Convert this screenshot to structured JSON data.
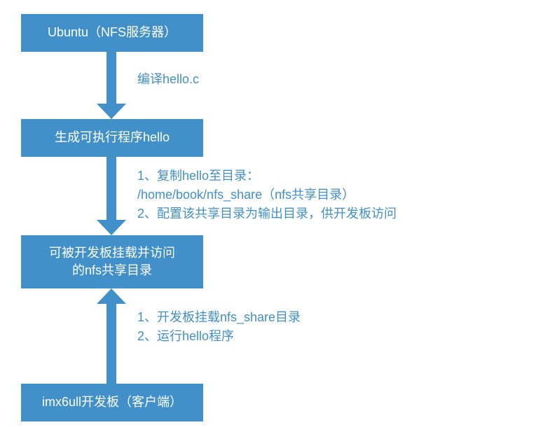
{
  "nodes": {
    "server": "Ubuntu（NFS服务器）",
    "compile_result": "生成可执行程序hello",
    "nfs_dir": "可被开发板挂载并访问\n的nfs共享目录",
    "client": "imx6ull开发板（客户端）"
  },
  "edges": {
    "compile": "编译hello.c",
    "deploy_line1": "1、复制hello至目录：",
    "deploy_line2": "/home/book/nfs_share（nfs共享目录）",
    "deploy_line3": "2、配置该共享目录为输出目录，供开发板访问",
    "mount_line1": "1、开发板挂载nfs_share目录",
    "mount_line2": "2、运行hello程序"
  },
  "chart_data": {
    "type": "diagram",
    "title": "",
    "nodes": [
      {
        "id": "server",
        "label": "Ubuntu（NFS服务器）"
      },
      {
        "id": "compile_result",
        "label": "生成可执行程序hello"
      },
      {
        "id": "nfs_dir",
        "label": "可被开发板挂载并访问的nfs共享目录"
      },
      {
        "id": "client",
        "label": "imx6ull开发板（客户端）"
      }
    ],
    "edges": [
      {
        "from": "server",
        "to": "compile_result",
        "label": "编译hello.c"
      },
      {
        "from": "compile_result",
        "to": "nfs_dir",
        "label": "1、复制hello至目录：/home/book/nfs_share（nfs共享目录） 2、配置该共享目录为输出目录，供开发板访问"
      },
      {
        "from": "client",
        "to": "nfs_dir",
        "label": "1、开发板挂载nfs_share目录 2、运行hello程序"
      }
    ]
  }
}
